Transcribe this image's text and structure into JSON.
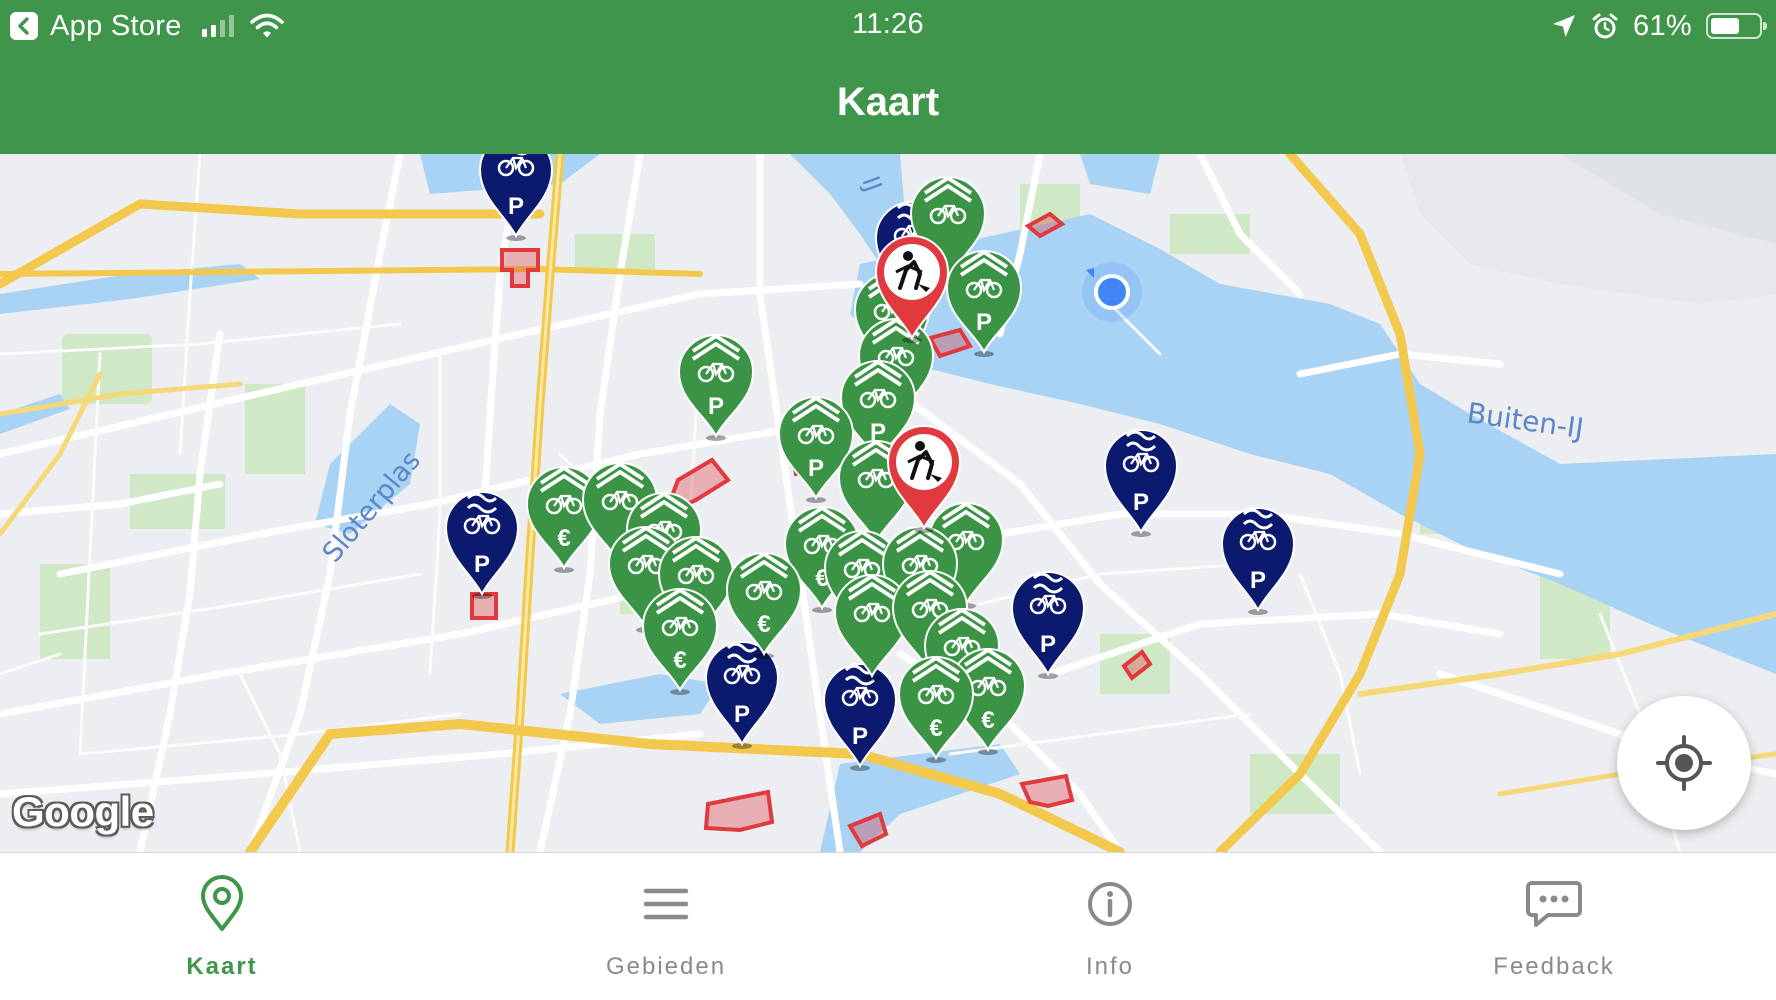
{
  "status_bar": {
    "back_app": "App Store",
    "time": "11:26",
    "battery_percent": "61%",
    "battery_level": 0.61
  },
  "nav": {
    "title": "Kaart"
  },
  "map": {
    "labels": {
      "ij": "IJ",
      "buiten_ij": "Buiten-IJ",
      "sloterplas": "Sloterplas"
    },
    "attribution": "Google",
    "pin_glyphs": {
      "parking": "P",
      "paid": "€"
    }
  },
  "colors": {
    "brand_green": "#3f964a",
    "pin_green": "#3b9446",
    "pin_navy": "#0b1a6e",
    "area_red": "#e0393e",
    "user_dot": "#4285f4"
  },
  "tabs": [
    {
      "label": "Kaart",
      "icon": "map-pin-icon",
      "active": true
    },
    {
      "label": "Gebieden",
      "icon": "list-icon",
      "active": false
    },
    {
      "label": "Info",
      "icon": "info-icon",
      "active": false
    },
    {
      "label": "Feedback",
      "icon": "chat-bubble-icon",
      "active": false
    }
  ]
}
